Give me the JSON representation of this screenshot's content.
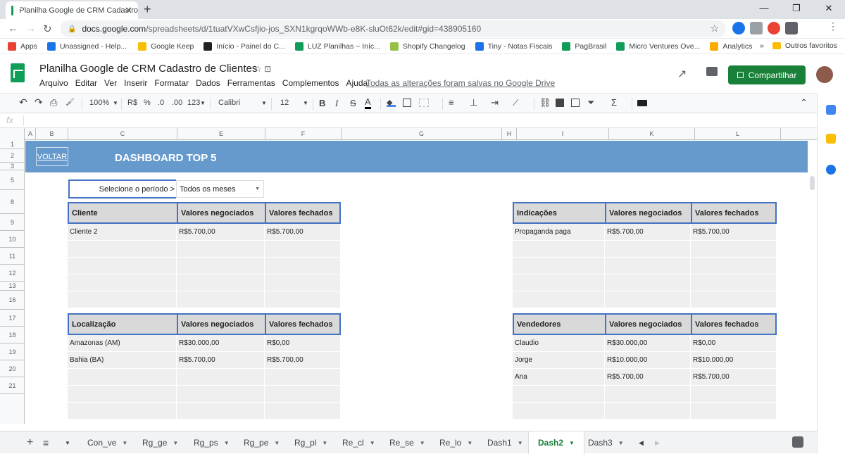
{
  "browser": {
    "tab_title": "Planilha Google de CRM Cadastro",
    "tab_close": "✕",
    "new_tab": "+",
    "window_controls": [
      "—",
      "❐",
      "✕"
    ],
    "nav": {
      "back": "←",
      "forward": "→",
      "reload": "↻"
    },
    "url_host": "docs.google.com",
    "url_path": "/spreadsheets/d/1tuatVXwCsfjio-jos_SXN1kgrqoWWb-e8K-sluOt62k/edit#gid=438905160",
    "lock": "🔒",
    "star": "☆"
  },
  "bookmarks": {
    "items": [
      {
        "label": "Apps",
        "color": "#ea4335"
      },
      {
        "label": "Unassigned - Help...",
        "color": "#1a73e8"
      },
      {
        "label": "Google Keep",
        "color": "#fbbc04"
      },
      {
        "label": "Início - Painel do C...",
        "color": "#202124"
      },
      {
        "label": "LUZ Planilhas ~ Iníc...",
        "color": "#0f9d58"
      },
      {
        "label": "Shopify Changelog",
        "color": "#95bf47"
      },
      {
        "label": "Tiny - Notas Fiscais",
        "color": "#1a73e8"
      },
      {
        "label": "PagBrasil",
        "color": "#0f9d58"
      },
      {
        "label": "Micro Ventures Ove...",
        "color": "#0f9d58"
      },
      {
        "label": "Analytics",
        "color": "#f9ab00"
      }
    ],
    "more": "»",
    "others": "Outros favoritos"
  },
  "header": {
    "doc_title": "Planilha  Google de CRM Cadastro de Clientes",
    "icons": "☆  ⊡",
    "menu": [
      "Arquivo",
      "Editar",
      "Ver",
      "Inserir",
      "Formatar",
      "Dados",
      "Ferramentas",
      "Complementos",
      "Ajuda"
    ],
    "save_status": "Todas as alterações foram salvas no Google Drive",
    "share_label": "Compartilhar",
    "trend_icon": "↗"
  },
  "toolbar": {
    "undo": "↶",
    "redo": "↷",
    "print": "⎙",
    "paint": "🖌",
    "zoom": "100%",
    "currency": "R$",
    "percent": "%",
    "dec_less": ".0",
    "dec_more": ".00",
    "number_format": "123",
    "font": "Calibri",
    "font_size": "12",
    "bold": "B",
    "italic": "I",
    "strike": "S",
    "text_color": "A",
    "collapse": "⌃"
  },
  "formula_bar": {
    "fx": "fx"
  },
  "columns": [
    {
      "label": "A",
      "w": 15
    },
    {
      "label": "B",
      "w": 46
    },
    {
      "label": "C",
      "w": 155
    },
    {
      "label": "E",
      "w": 125
    },
    {
      "label": "F",
      "w": 108
    },
    {
      "label": "G",
      "w": 228
    },
    {
      "label": "H",
      "w": 21
    },
    {
      "label": "I",
      "w": 131
    },
    {
      "label": "K",
      "w": 122
    },
    {
      "label": "L",
      "w": 122
    }
  ],
  "rows": [
    "1",
    "2",
    "3",
    "5",
    "8",
    "9",
    "10",
    "11",
    "12",
    "13",
    "16",
    "17",
    "18",
    "19",
    "20",
    "21"
  ],
  "dashboard": {
    "voltar": "VOLTAR",
    "title": "DASHBOARD TOP 5",
    "period_label": "Selecione o período >",
    "period_value": "Todos os meses",
    "caret": "▼"
  },
  "tables": {
    "clientes": {
      "headers": [
        "Cliente",
        "Valores negociados",
        "Valores fechados"
      ],
      "rows": [
        [
          "Cliente 2",
          "R$5.700,00",
          "R$5.700,00"
        ],
        [
          "",
          "",
          ""
        ],
        [
          "",
          "",
          ""
        ],
        [
          "",
          "",
          ""
        ],
        [
          "",
          "",
          ""
        ]
      ]
    },
    "indicacoes": {
      "headers": [
        "Indicações",
        "Valores negociados",
        "Valores fechados"
      ],
      "rows": [
        [
          "Propaganda paga",
          "R$5.700,00",
          "R$5.700,00"
        ],
        [
          "",
          "",
          ""
        ],
        [
          "",
          "",
          ""
        ],
        [
          "",
          "",
          ""
        ],
        [
          "",
          "",
          ""
        ]
      ]
    },
    "localizacao": {
      "headers": [
        "Localização",
        "Valores negociados",
        "Valores fechados"
      ],
      "rows": [
        [
          "Amazonas (AM)",
          "R$30.000,00",
          "R$0,00"
        ],
        [
          "Bahia (BA)",
          "R$5.700,00",
          "R$5.700,00"
        ],
        [
          "",
          "",
          ""
        ],
        [
          "",
          "",
          ""
        ],
        [
          "",
          "",
          ""
        ]
      ]
    },
    "vendedores": {
      "headers": [
        "Vendedores",
        "Valores negociados",
        "Valores fechados"
      ],
      "rows": [
        [
          "Claudio",
          "R$30.000,00",
          "R$0,00"
        ],
        [
          "Jorge",
          "R$10.000,00",
          "R$10.000,00"
        ],
        [
          "Ana",
          "R$5.700,00",
          "R$5.700,00"
        ],
        [
          "",
          "",
          ""
        ],
        [
          "",
          "",
          ""
        ]
      ]
    }
  },
  "sheet_tabs": {
    "add": "+",
    "all": "≡",
    "tabs": [
      "Con_ve",
      "Rg_ge",
      "Rg_ps",
      "Rg_pe",
      "Rg_pl",
      "Re_cl",
      "Re_se",
      "Re_lo",
      "Dash1",
      "Dash2",
      "Dash3"
    ],
    "active": "Dash2",
    "dropdown": "▼",
    "nav_prev": "◀",
    "nav_next": "▶"
  }
}
